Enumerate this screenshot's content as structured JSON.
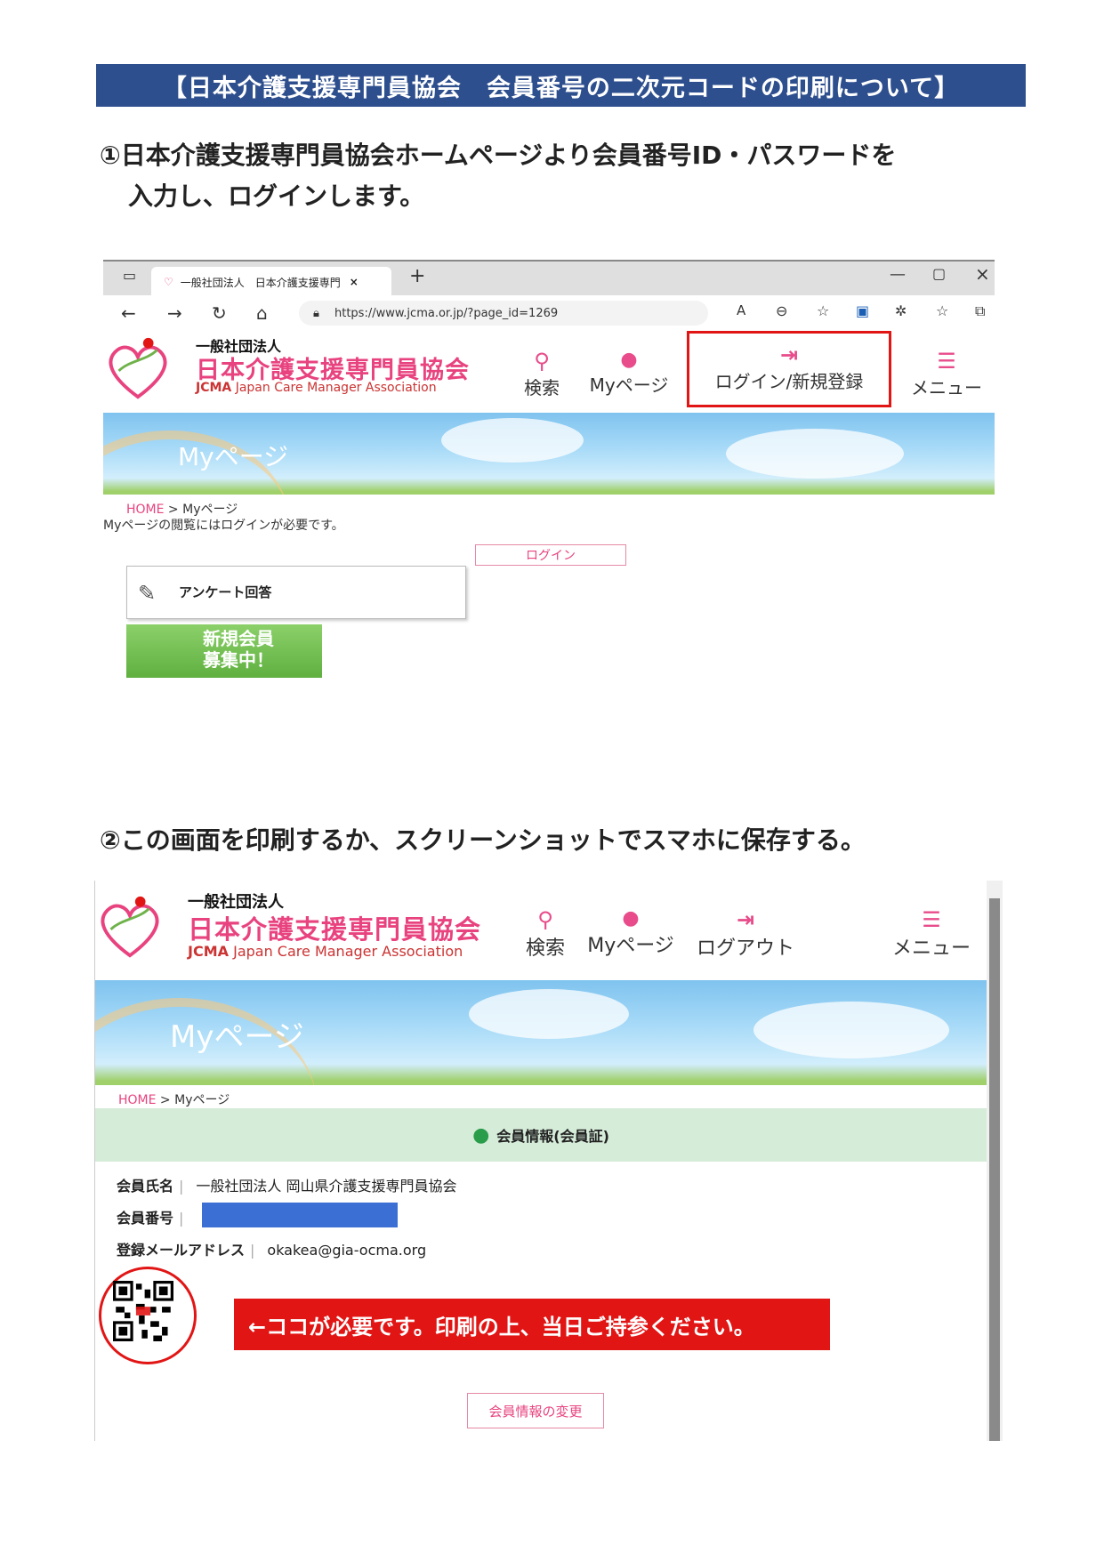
{
  "title": "【日本介護支援専門員協会　会員番号の二次元コードの印刷について】",
  "step1": {
    "line1": "①日本介護支援専門員協会ホームページより会員番号ID・パスワードを",
    "line2": "入力し、ログインします。"
  },
  "step2": "②この画面を印刷するか、スクリーンショットでスマホに保存する。",
  "browser": {
    "tab_title": "一般社団法人　日本介護支援専門",
    "url": "https://www.jcma.or.jp/?page_id=1269"
  },
  "site": {
    "org_small": "一般社団法人",
    "org_name": "日本介護支援専門員協会",
    "org_en_bold": "JCMA",
    "org_en": "Japan Care Manager Association",
    "nav": {
      "search": "検索",
      "mypage": "Myページ",
      "login": "ログイン/新規登録",
      "logout": "ログアウト",
      "menu": "メニュー"
    },
    "banner": "Myページ",
    "crumb_home": "HOME",
    "crumb_sep": " > Myページ",
    "login_required": "Myページの閲覧にはログインが必要です。",
    "login_button": "ログイン",
    "survey": "アンケート回答",
    "recruit_line1": "新規会員",
    "recruit_line2": "募集中！"
  },
  "member": {
    "heading": "会員情報(会員証)",
    "name_label": "会員氏名",
    "name_value": "一般社団法人 岡山県介護支援専門員協会",
    "number_label": "会員番号",
    "email_label": "登録メールアドレス",
    "email_value": "okakea@gia-ocma.org",
    "note": "←ココが必要です。印刷の上、当日ご持参ください。",
    "change_button": "会員情報の変更"
  },
  "colors": {
    "title_bg": "#2e4f8e",
    "brand_pink": "#e8437f",
    "highlight_red": "#e21515",
    "member_band": "#d5ecd9",
    "redacted": "#3c6fd4"
  }
}
